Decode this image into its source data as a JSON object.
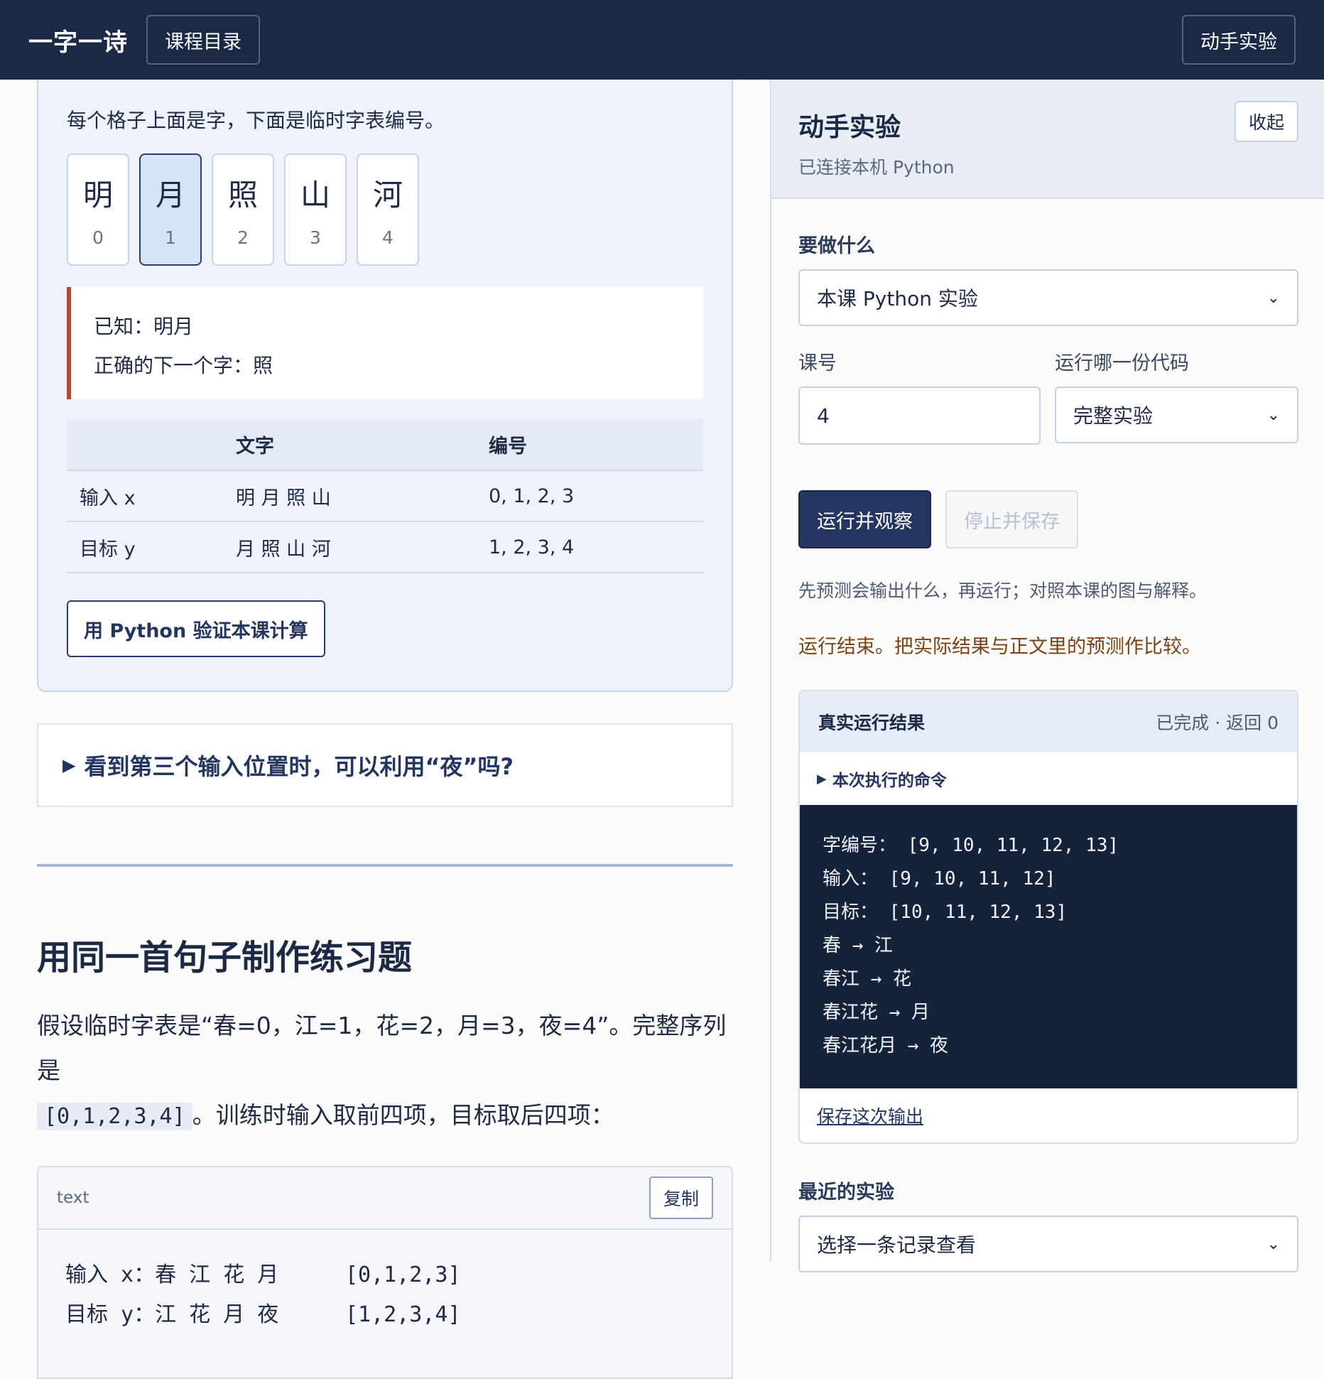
{
  "topbar": {
    "brand": "一字一诗",
    "catalog_button": "课程目录",
    "lab_button": "动手实验"
  },
  "panel": {
    "intro": "每个格子上面是字，下面是临时字表编号。",
    "cells": [
      {
        "char": "明",
        "index": "0"
      },
      {
        "char": "月",
        "index": "1"
      },
      {
        "char": "照",
        "index": "2"
      },
      {
        "char": "山",
        "index": "3"
      },
      {
        "char": "河",
        "index": "4"
      }
    ],
    "known_line1": "已知：明月",
    "known_line2": "正确的下一个字：照",
    "table": {
      "headers": [
        "",
        "文字",
        "编号"
      ],
      "rows": [
        [
          "输入 x",
          "明 月 照 山",
          "0, 1, 2, 3"
        ],
        [
          "目标 y",
          "月 照 山 河",
          "1, 2, 3, 4"
        ]
      ]
    },
    "verify_button": "用 Python 验证本课计算"
  },
  "question": {
    "text": "看到第三个输入位置时，可以利用“夜”吗?"
  },
  "section": {
    "title": "用同一首句子制作练习题",
    "para_before": "假设临时字表是“春=0，江=1，花=2，月=3，夜=4”。完整序列是",
    "inline_code": "[0,1,2,3,4]",
    "para_after": "。训练时输入取前四项，目标取后四项："
  },
  "codebox": {
    "lang": "text",
    "copy_button": "复制",
    "lines": [
      {
        "left": "输入 x：春 江 花 月",
        "right": "[0,1,2,3]"
      },
      {
        "left": "目标 y：江 花 月 夜",
        "right": "[1,2,3,4]"
      }
    ]
  },
  "sidebar": {
    "title": "动手实验",
    "subtitle": "已连接本机 Python",
    "collapse_button": "收起",
    "task_label": "要做什么",
    "task_value": "本课 Python 实验",
    "lesson_label": "课号",
    "lesson_value": "4",
    "code_label": "运行哪一份代码",
    "code_value": "完整实验",
    "run_button": "运行并观察",
    "stop_button": "停止并保存",
    "hint": "先预测会输出什么，再运行；对照本课的图与解释。",
    "done_message": "运行结束。把实际结果与正文里的预测作比较。",
    "result": {
      "title": "真实运行结果",
      "status": "已完成 · 返回 0",
      "command_toggle": "本次执行的命令",
      "output": [
        "字编号： [9, 10, 11, 12, 13]",
        "输入： [9, 10, 11, 12]",
        "目标： [10, 11, 12, 13]",
        "春 → 江",
        "春江 → 花",
        "春江花 → 月",
        "春江花月 → 夜"
      ],
      "save_link": "保存这次输出"
    },
    "recent_label": "最近的实验",
    "recent_placeholder": "选择一条记录查看"
  },
  "icons": {
    "dropdown": "chevron-down-icon",
    "disclosure": "triangle-right-icon"
  },
  "colors": {
    "topbar_bg": "#1c2945",
    "accent": "#24365f",
    "warning_border": "#b5452c",
    "done_text": "#7a4213",
    "terminal_bg": "#16213a"
  }
}
